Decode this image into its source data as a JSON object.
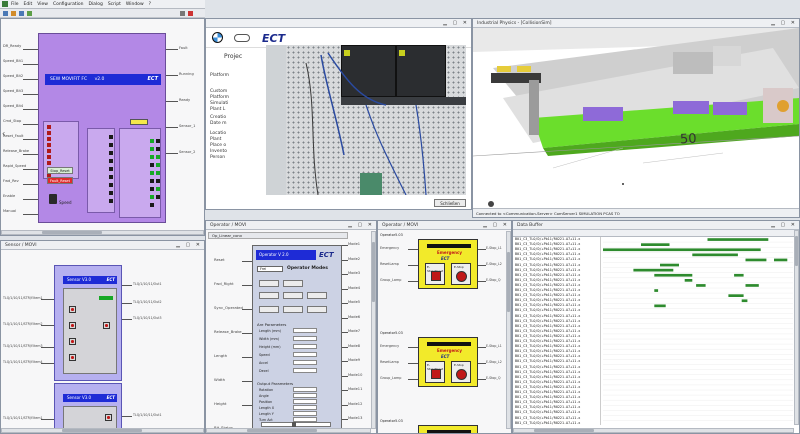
{
  "app": {
    "menu_items": [
      "File",
      "Edit",
      "View",
      "Configuration",
      "Dialog",
      "Script",
      "Window",
      "?"
    ]
  },
  "panel_a": {
    "hmi_title": "SEW MOVIFIT FC",
    "hmi_version": "v2.0",
    "hmi_brand": "ECT",
    "green_btn": "Stop_Reset",
    "red_btn": "Fault_Reset",
    "speed_label": "Speed",
    "left_pins": [
      "DR_Ready",
      "Speed_Bit1",
      "Speed_Bit2",
      "Speed_Bit3",
      "Speed_Bit4",
      "Cmd_Stop",
      "Reset_Fault",
      "Release_Brake",
      "Rapid_Speed",
      "Fwd_Rev",
      "Enable",
      "Manual"
    ],
    "right_pins": [
      "Fault",
      "Running",
      "Ready",
      "Sensor_1",
      "Sensor_2"
    ]
  },
  "panel_b": {
    "logos": [
      "BMW",
      "MINI",
      "ECT"
    ],
    "heading": "Projec",
    "info_lines": [
      "Platform",
      "Custom",
      "Platform",
      "Simulati",
      "Plant L",
      "Creatio",
      "Date m",
      "Locatio",
      "Plant",
      "Place o",
      "Invento",
      "Person"
    ],
    "close_btn": "Schließen"
  },
  "panel_c": {
    "title": "Industrial Physics - [CollisionSim]",
    "floor_number": "50",
    "status_text": "Connected to <Communication-Server> ComServer1 SIMULATION PCAS TO"
  },
  "panel_d": {
    "title": "Sensor / MOVI",
    "frames": [
      {
        "header": "Sensor V3.0",
        "brand": "ECT",
        "left_pins": [
          "TLQ/1/10/11/STR/Y.Item1",
          "TLQ/1/10/11/STR/Y.Item2",
          "TLQ/1/10/11/STR/Y.Item3",
          "TLQ/1/10/11/STR/Y.Item4"
        ],
        "right_pins": [
          "TLQ/1/10/11/Out1",
          "TLQ/1/10/11/Out2",
          "TLQ/1/10/11/Out3"
        ]
      },
      {
        "header": "Sensor V3.0",
        "brand": "ECT",
        "left_pins": [
          "TLQ/1/10/11/STR/Y.Item1"
        ],
        "right_pins": [
          "TLQ/1/10/11/Out1"
        ]
      }
    ]
  },
  "panel_e": {
    "title": "Operator / MOVI",
    "tab": "Op_Linear_conv",
    "hmi_header": "Operator V 2.0",
    "hmi_brand": "ECT",
    "mode_box": "Frei",
    "mode_label": "Operator Modes",
    "left_pins": [
      "Reset",
      "Fwd_Right",
      "Sync_Operated",
      "Release_Brake",
      "Length",
      "Width",
      "Height",
      "Bit_Status"
    ],
    "right_pins": [
      "Mode1",
      "Mode2",
      "Mode3",
      "Mode4",
      "Mode5",
      "Mode6",
      "Mode7",
      "Mode8",
      "Mode9",
      "Mode10",
      "Mode11",
      "Mode12",
      "Mode13"
    ],
    "section1": "Are Parameters",
    "section2": "Output Parameters",
    "param_rows": [
      "Length (mm)",
      "Width (mm)",
      "Height (mm)",
      "Speed",
      "Accel",
      "Decel",
      "Rotation",
      "Angle",
      "Position",
      "Length X",
      "Length Y",
      "Turn Act"
    ]
  },
  "panel_f": {
    "title": "Operator / MOVI",
    "boxes": [
      {
        "header": "Operator5.03",
        "label": "Emergency",
        "brand": "ECT",
        "btn1": "E-Stop/Reset",
        "btn2": "E-Stop",
        "left_pins": [
          "Emergency",
          "ResetLamp",
          "Group_Lamp"
        ],
        "right_pins": [
          "E-Stop_L1",
          "E-Stop_L2",
          "E-Stop_Q"
        ]
      },
      {
        "header": "Operator5.03",
        "label": "Emergency",
        "brand": "ECT",
        "btn1": "E-Stop/Reset",
        "btn2": "E-Stop",
        "left_pins": [
          "Emergency",
          "ResetLamp",
          "Group_Lamp"
        ],
        "right_pins": [
          "E-Stop_L1",
          "E-Stop_L2",
          "E-Stop_Q"
        ]
      },
      {
        "header": "Operator5.03",
        "label": "Emergency",
        "brand": "ECT",
        "btn1": "",
        "btn2": "",
        "left_pins": [],
        "right_pins": []
      }
    ]
  },
  "panel_g": {
    "title": "Data Buffer",
    "col_header": "",
    "rows": [
      "B01_C3_TLO/D/+Pb11/R0221-A7+11.x",
      "B01_C3_TLO/D/+Pb11/R0221-A7+11.x",
      "B01_C3_TLO/D/+Pb11/R0221-A7+11.x",
      "B01_C3_TLO/D/+Pb11/R0221-A7+11.x",
      "B01_C3_TLO/D/+Pb11/R0221-A7+11.x",
      "B01_C3_TLO/D/+Pb11/R0221-A7+11.x",
      "B01_C3_TLO/D/+Pb11/R0221-A7+11.x",
      "B01_C3_TLO/D/+Pb11/R0221-A7+11.x",
      "B01_C3_TLO/D/+Pb11/R0221-A7+11.x",
      "B01_C3_TLO/D/+Pb11/R0221-A7+11.x",
      "B01_C3_TLO/D/+Pb11/R0221-A7+11.x",
      "B01_C3_TLO/D/+Pb11/R0221-A7+11.x",
      "B01_C3_TLO/D/+Pb11/R0221-A7+11.x",
      "B01_C3_TLO/D/+Pb11/R0221-A7+11.x",
      "B01_C3_TLO/D/+Pb11/R0221-A7+11.x",
      "B01_C3_TLO/D/+Pb11/R0221-A7+11.x",
      "B01_C3_TLO/D/+Pb11/R0221-A7+11.x",
      "B01_C3_TLO/D/+Pb11/R0221-A7+11.x",
      "B01_C3_TLO/D/+Pb11/R0221-A7+11.x",
      "B01_C3_TLO/D/+Pb11/R0221-A7+11.x",
      "B01_C3_TLO/D/+Pb11/R0221-A7+11.x",
      "B01_C3_TLO/D/+Pb11/R0221-A7+11.x",
      "B01_C3_TLO/D/+Pb11/R0221-A7+11.x",
      "B01_C3_TLO/D/+Pb11/R0221-A7+11.x",
      "B01_C3_TLO/D/+Pb11/R0221-A7+11.x",
      "B01_C3_TLO/D/+Pb11/R0221-A7+11.x",
      "B01_C3_TLO/D/+Pb11/R0221-A7+11.x",
      "B01_C3_TLO/D/+Pb11/R0221-A7+11.x",
      "B01_C3_TLO/D/+Pb11/R0221-A7+11.x",
      "B01_C3_TLO/D/+Pb11/R0221-A7+11.x",
      "B01_C3_TLO/D/+Pb11/R0221-A7+11.x",
      "B01_C3_TLO/D/+Pb11/R0221-A7+11.x",
      "B01_C3_TLO/D/+Pb11/R0221-A7+11.x",
      "B01_C3_TLO/D/+Pb11/R0221-A7+11.x",
      "B01_C3_TLO/D/+Pb11/R0221-A7+11.x",
      "B01_C3_TLO/D/+Pb11/R0221-A7+11.x",
      "B01_C3_TLO/D/+Pb11/R0221-A7+11.x"
    ],
    "signals": [
      [
        [
          0.55,
          0.87
        ]
      ],
      [
        [
          0.2,
          0.35
        ]
      ],
      [
        [
          0.0,
          0.83
        ]
      ],
      [
        [
          0.47,
          0.71
        ]
      ],
      [
        [
          0.75,
          0.86
        ],
        [
          0.9,
          0.97
        ]
      ],
      [
        [
          0.3,
          0.4
        ]
      ],
      [
        [
          0.16,
          0.37
        ]
      ],
      [
        [
          0.27,
          0.47
        ],
        [
          0.69,
          0.74
        ]
      ],
      [
        [
          0.43,
          0.47
        ]
      ],
      [
        [
          0.49,
          0.54
        ],
        [
          0.75,
          0.82
        ]
      ],
      [
        [
          0.27,
          0.29
        ]
      ],
      [
        [
          0.66,
          0.74
        ]
      ],
      [
        [
          0.73,
          0.76
        ]
      ],
      [
        [
          0.27,
          0.33
        ]
      ],
      [],
      [],
      [],
      [],
      [],
      [],
      [],
      [],
      [],
      [],
      [],
      [],
      [],
      [],
      [],
      [],
      [],
      [],
      [],
      [],
      [],
      [],
      []
    ],
    "signal_color": "#2e8b2e"
  },
  "colors": {
    "hmi_purple": "#b388e6",
    "hmi_blue": "#1e2bd6",
    "emergency_yellow": "#f2ea2a",
    "sim_green": "#6bde2c",
    "sim_purple": "#8e6ad8"
  }
}
